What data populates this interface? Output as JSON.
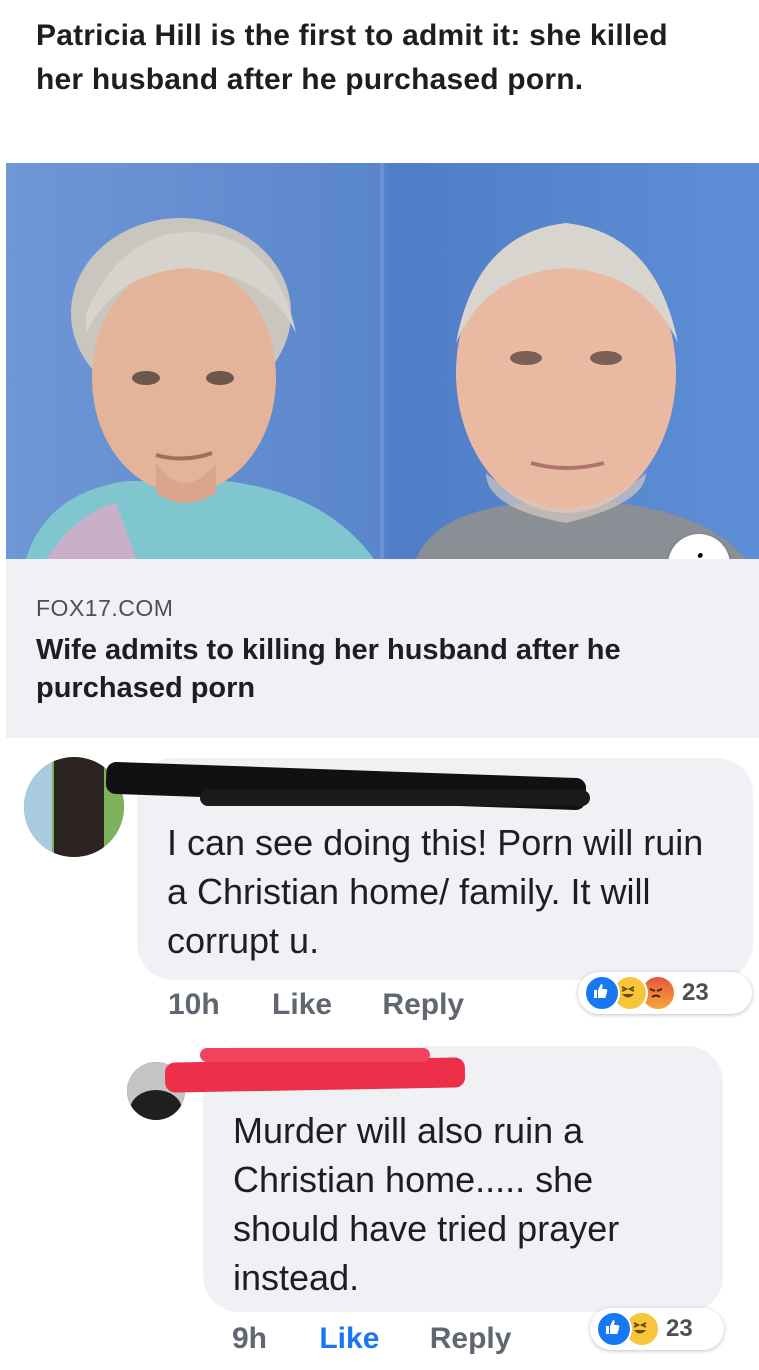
{
  "post": {
    "text": "Patricia Hill is the first to admit it: she killed her husband after he purchased porn."
  },
  "link_preview": {
    "domain": "FOX17.COM",
    "headline": "Wife admits to killing her husband after he purchased porn",
    "info_icon": "info-icon"
  },
  "comments": [
    {
      "text": "I can see doing this! Porn will ruin a Christian home/ family. It will corrupt u.",
      "time": "10h",
      "like_label": "Like",
      "reply_label": "Reply",
      "reactions": [
        "like",
        "haha",
        "angry"
      ],
      "reaction_count": "23",
      "redaction_color": "#111111"
    },
    {
      "text": "Murder will also ruin a Christian home..... she should have tried prayer instead.",
      "time": "9h",
      "like_label": "Like",
      "like_active_color": "#1877f2",
      "reply_label": "Reply",
      "reactions": [
        "like",
        "haha"
      ],
      "reaction_count": "23",
      "redaction_color": "#ee2f4a"
    }
  ]
}
